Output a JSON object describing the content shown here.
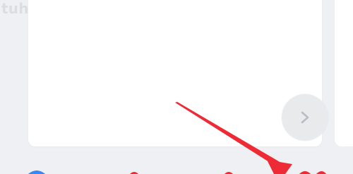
{
  "watermark": {
    "text": "tuhuaba.com"
  },
  "next_button": {
    "icon": "chevron-right-icon"
  },
  "annotation": {
    "color": "#ee2b34",
    "icon": "red-arrow-annotation"
  },
  "bottom_bar": {
    "icons": [
      "blue-icon-partial",
      "red-icon-partial",
      "red-icon-partial",
      "red-icon-partial",
      "red-icon-partial"
    ]
  }
}
